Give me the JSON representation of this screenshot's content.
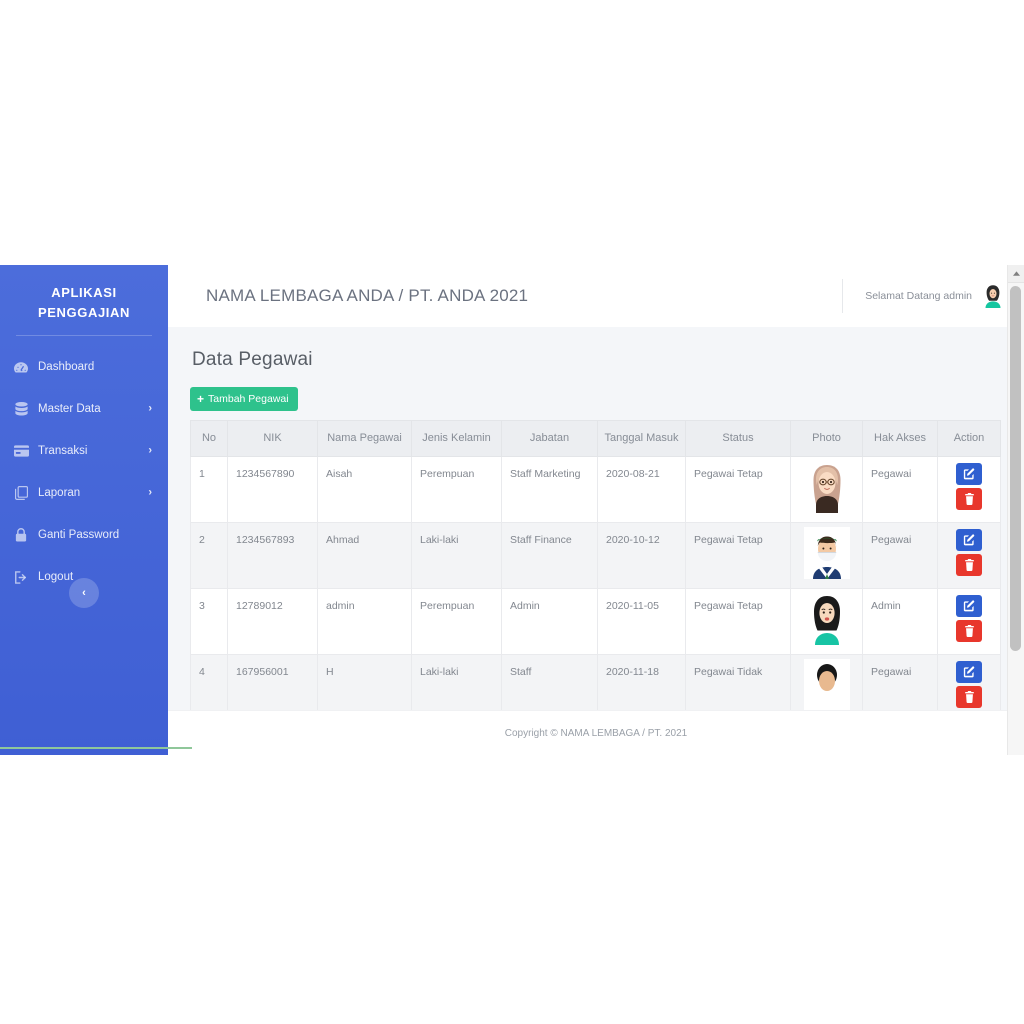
{
  "sidebar": {
    "brand_line1": "APLIKASI",
    "brand_line2": "PENGGAJIAN",
    "collapse_label": "‹",
    "items": [
      {
        "label": "Dashboard",
        "icon": "tachometer-icon",
        "caret": ""
      },
      {
        "label": "Master Data",
        "icon": "database-icon",
        "caret": "›"
      },
      {
        "label": "Transaksi",
        "icon": "credit-card-icon",
        "caret": "›"
      },
      {
        "label": "Laporan",
        "icon": "copy-files-icon",
        "caret": "›"
      },
      {
        "label": "Ganti Password",
        "icon": "lock-icon",
        "caret": ""
      },
      {
        "label": "Logout",
        "icon": "sign-out-icon",
        "caret": ""
      }
    ]
  },
  "topbar": {
    "title": "NAMA LEMBAGA ANDA / PT. ANDA 2021",
    "welcome": "Selamat Datang admin",
    "avatar": "woman-hijab-avatar"
  },
  "main": {
    "page_title": "Data Pegawai",
    "add_button": "Tambah Pegawai",
    "add_button_plus": "+"
  },
  "table": {
    "headers": [
      "No",
      "NIK",
      "Nama Pegawai",
      "Jenis Kelamin",
      "Jabatan",
      "Tanggal Masuk",
      "Status",
      "Photo",
      "Hak Akses",
      "Action"
    ],
    "rows": [
      {
        "no": "1",
        "nik": "1234567890",
        "nama": "Aisah",
        "kelamin": "Perempuan",
        "jabatan": "Staff Marketing",
        "tanggal": "2020-08-21",
        "status": "Pegawai Tetap",
        "photo": "woman-hijab-glasses-avatar",
        "hak_akses": "Pegawai"
      },
      {
        "no": "2",
        "nik": "1234567893",
        "nama": "Ahmad",
        "kelamin": "Laki-laki",
        "jabatan": "Staff Finance",
        "tanggal": "2020-10-12",
        "status": "Pegawai Tetap",
        "photo": "man-mask-suit-avatar",
        "hak_akses": "Pegawai"
      },
      {
        "no": "3",
        "nik": "12789012",
        "nama": "admin",
        "kelamin": "Perempuan",
        "jabatan": "Admin",
        "tanggal": "2020-11-05",
        "status": "Pegawai Tetap",
        "photo": "woman-black-hijab-avatar",
        "hak_akses": "Admin"
      },
      {
        "no": "4",
        "nik": "167956001",
        "nama": "H",
        "kelamin": "Laki-laki",
        "jabatan": "Staff",
        "tanggal": "2020-11-18",
        "status": "Pegawai Tidak",
        "photo": "person-avatar",
        "hak_akses": "Pegawai"
      }
    ],
    "action_edit": "edit-icon",
    "action_delete": "trash-icon"
  },
  "footer": {
    "copyright": "Copyright © NAMA LEMBAGA / PT. 2021"
  },
  "colors": {
    "sidebar": "#4a67d8",
    "accent_green": "#2ec28c",
    "edit_blue": "#2f5fd0",
    "delete_red": "#e8372c",
    "content_bg": "#f4f6f9"
  }
}
